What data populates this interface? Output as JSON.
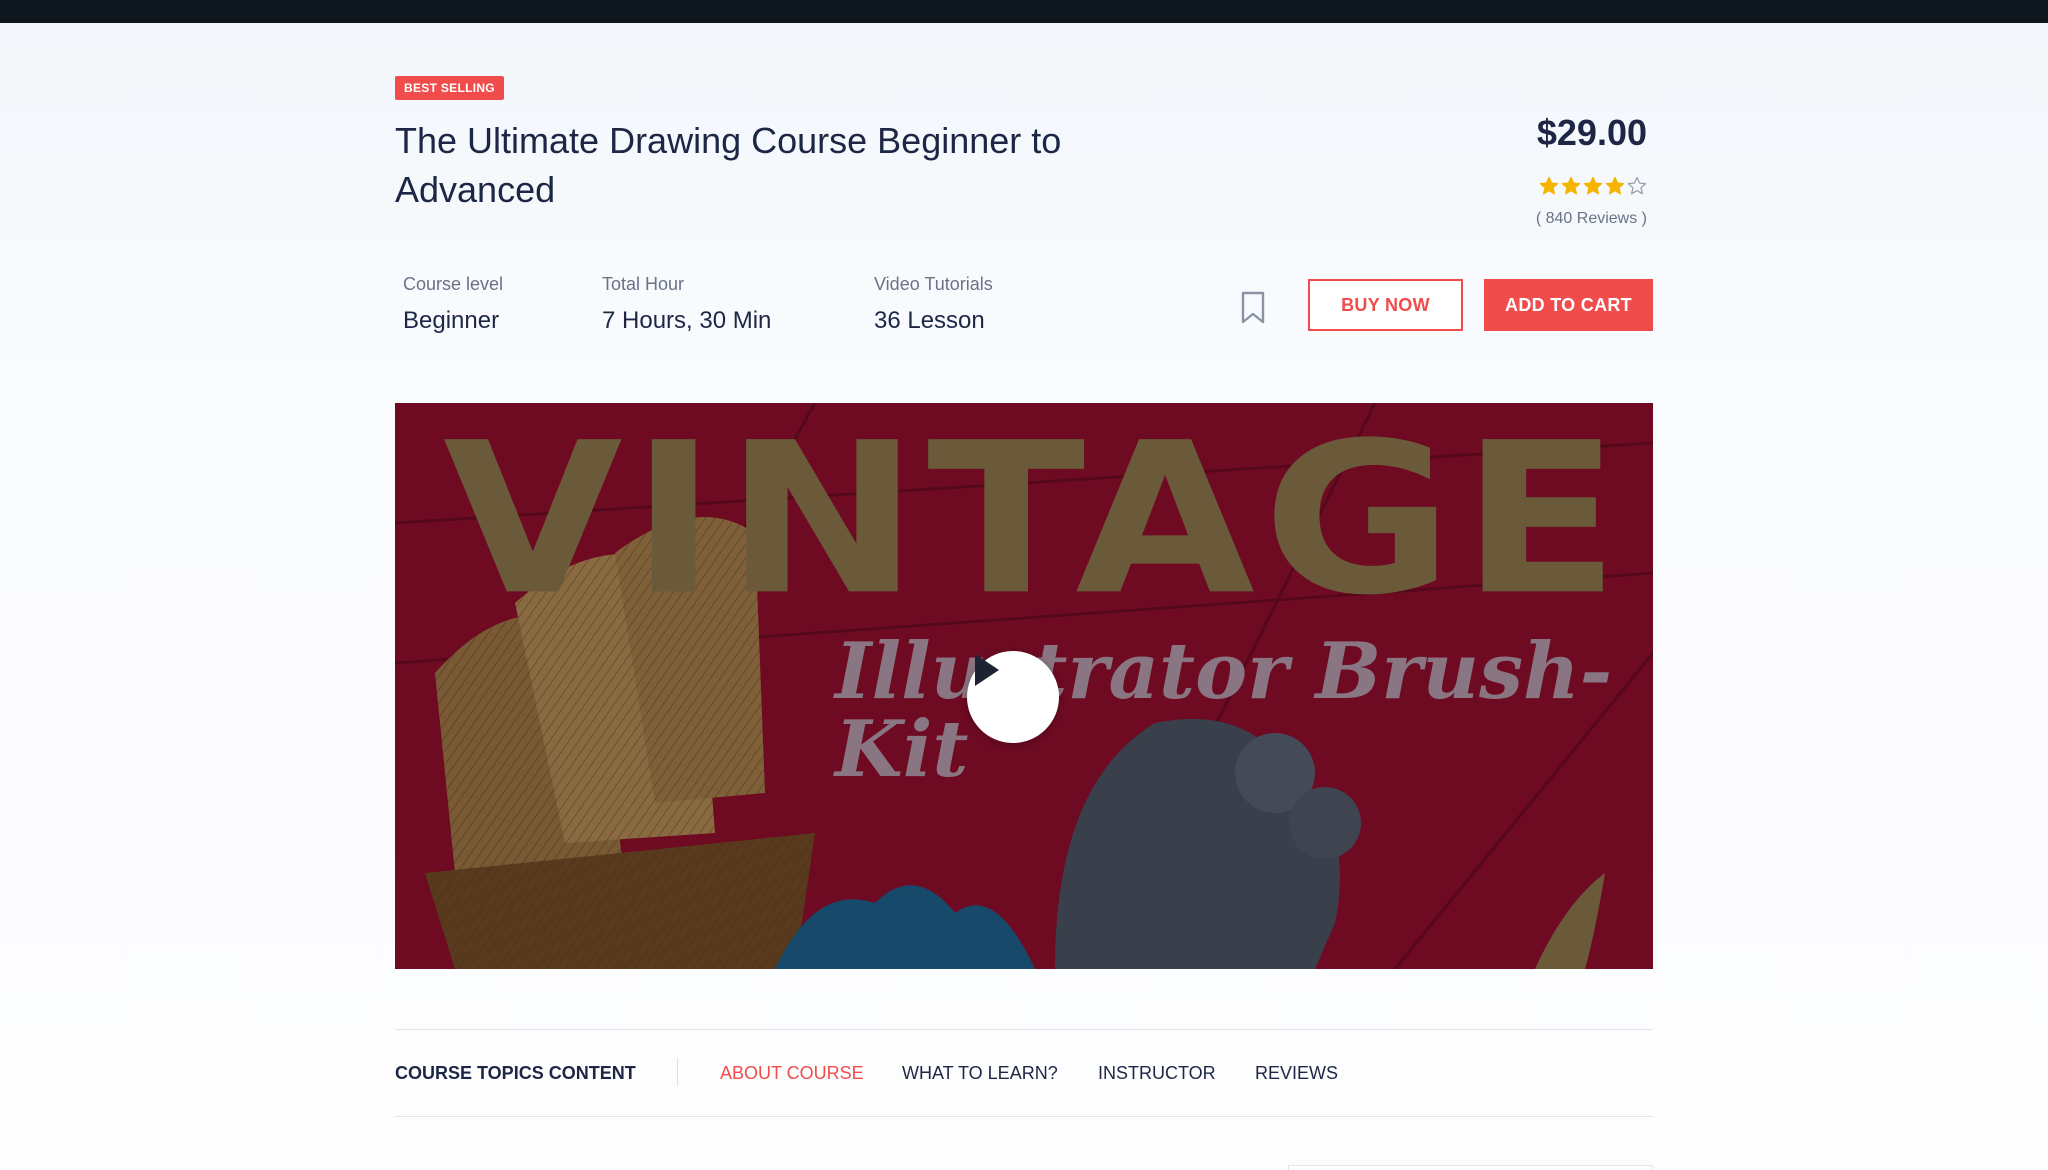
{
  "course": {
    "badge": "BEST SELLING",
    "title": "The Ultimate Drawing Course Beginner to Advanced",
    "price": "$29.00",
    "rating": 4,
    "rating_max": 5,
    "reviews": "( 840 Reviews )",
    "star_color": "#f5b400",
    "accent_color": "#f04c4c"
  },
  "meta": [
    {
      "label": "Course level",
      "value": "Beginner"
    },
    {
      "label": "Total Hour",
      "value": "7 Hours, 30 Min"
    },
    {
      "label": "Video Tutorials",
      "value": "36 Lesson"
    }
  ],
  "actions": {
    "bookmark_icon": "bookmark-icon",
    "buy_now": "BUY NOW",
    "add_to_cart": "ADD TO CART"
  },
  "video": {
    "headline": "VINTAGE",
    "subline": "Illustrator Brush-Kit",
    "play_icon": "play-icon"
  },
  "tabs": {
    "section_title": "COURSE TOPICS CONTENT",
    "items": [
      {
        "label": "ABOUT COURSE",
        "active": true
      },
      {
        "label": "WHAT TO LEARN?",
        "active": false
      },
      {
        "label": "INSTRUCTOR",
        "active": false
      },
      {
        "label": "REVIEWS",
        "active": false
      }
    ]
  }
}
